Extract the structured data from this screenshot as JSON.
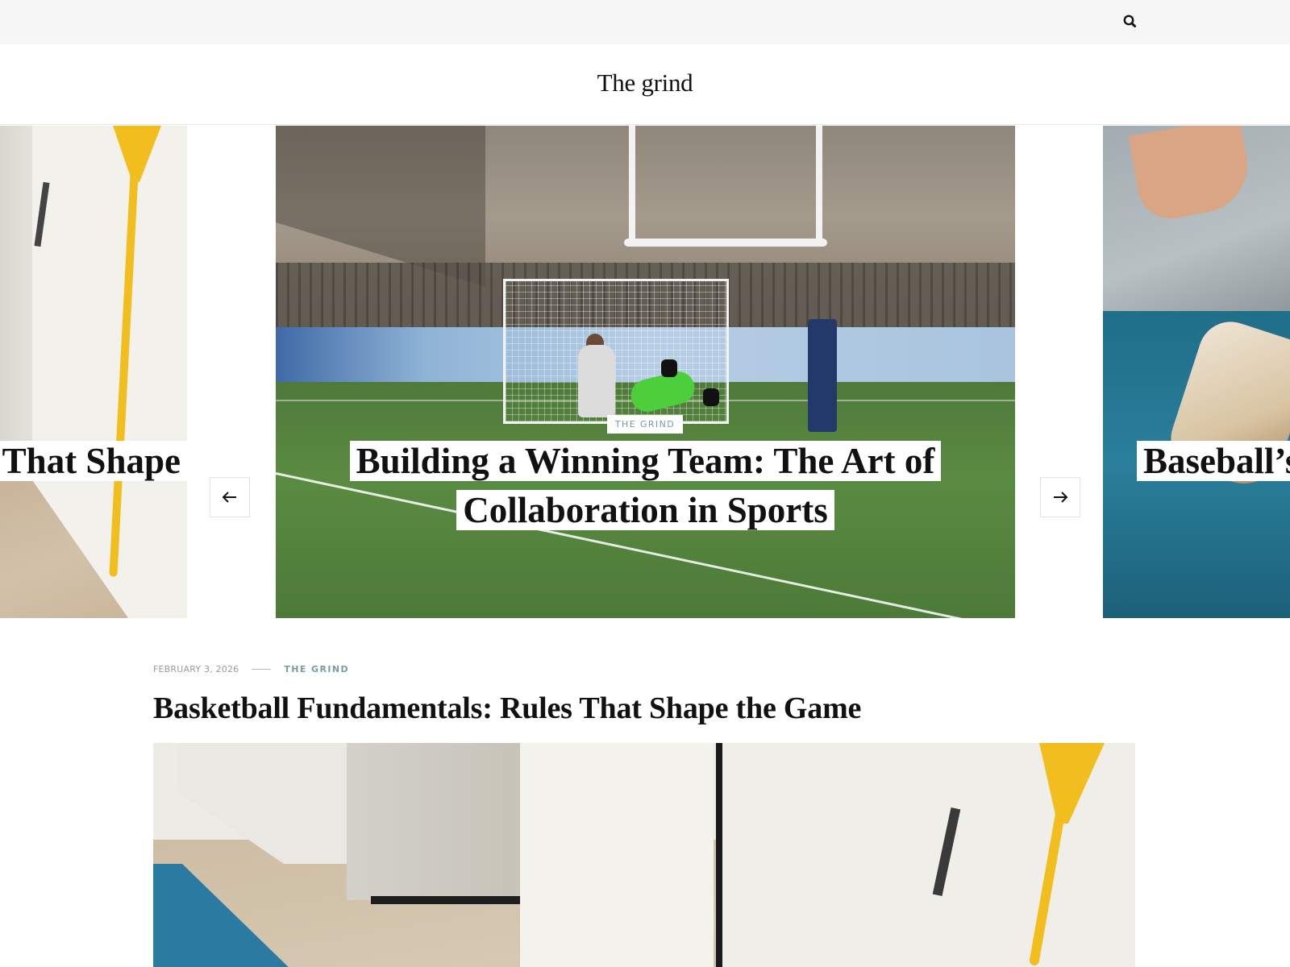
{
  "site": {
    "title": "The grind"
  },
  "topbar": {
    "search_icon": "search-icon"
  },
  "slider": {
    "prev_icon": "arrow-left-icon",
    "next_icon": "arrow-right-icon",
    "slides": [
      {
        "title": "That Shape"
      },
      {
        "category": "THE GRIND",
        "title": "Building a Winning Team: The Art of Collaboration in Sports"
      },
      {
        "title": "Baseball’s"
      }
    ]
  },
  "post": {
    "date": "FEBRUARY 3, 2026",
    "category": "THE GRIND",
    "title": "Basketball Fundamentals: Rules That Shape the Game"
  },
  "colors": {
    "accent": "#7a9aa6",
    "topbar_bg": "#f7f7f7",
    "text": "#111111"
  }
}
